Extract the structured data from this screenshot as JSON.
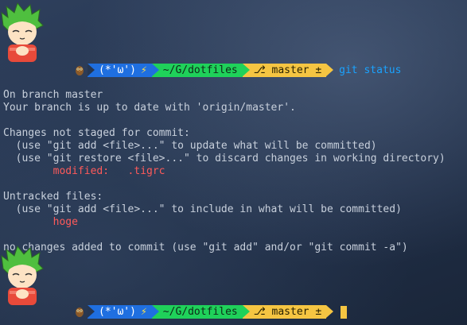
{
  "prompt": {
    "owl_icon": "owl-icon",
    "face": "(*'ω')",
    "bolt": "⚡",
    "dir": "~/G/dotfiles",
    "branch_icon": "⎇",
    "branch": "master ±",
    "command": "git status"
  },
  "output": {
    "l1": "On branch master",
    "l2": "Your branch is up to date with 'origin/master'.",
    "l3": "Changes not staged for commit:",
    "l4": "  (use \"git add <file>...\" to update what will be committed)",
    "l5": "  (use \"git restore <file>...\" to discard changes in working directory)",
    "l6_label": "        modified:",
    "l6_file": "   .tigrc",
    "l7": "Untracked files:",
    "l8": "  (use \"git add <file>...\" to include in what will be committed)",
    "l9": "        hoge",
    "l10": "no changes added to commit (use \"git add\" and/or \"git commit -a\")"
  },
  "colors": {
    "face_bg": "#1f6fe0",
    "dir_bg": "#1fd15a",
    "branch_bg": "#f5c542",
    "command": "#1aa3ff",
    "modified": "#ff5a5a"
  }
}
